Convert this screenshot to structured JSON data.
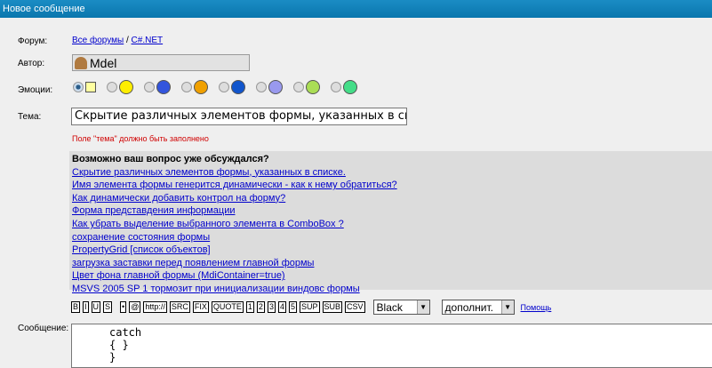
{
  "title": "Новое сообщение",
  "labels": {
    "forum": "Форум:",
    "author": "Автор:",
    "emotions": "Эмоции:",
    "subject": "Тема:",
    "message": "Сообщение:"
  },
  "forum": {
    "all": "Все форумы",
    "sep": "/",
    "current": "C#.NET"
  },
  "author": "Mdel",
  "emotions": [
    {
      "name": "note",
      "color": "#ffffa0",
      "selected": true
    },
    {
      "name": "smile",
      "color": "#ffee00"
    },
    {
      "name": "question",
      "color": "#3355dd"
    },
    {
      "name": "exclaim",
      "color": "#f0a000"
    },
    {
      "name": "sad",
      "color": "#1155cc"
    },
    {
      "name": "shock",
      "color": "#9999ee"
    },
    {
      "name": "cool",
      "color": "#aadd55"
    },
    {
      "name": "grin",
      "color": "#44dd88"
    }
  ],
  "subject": "Скрытие различных элементов формы, указанных в списке",
  "error": "Поле \"тема\" должно быть заполнено",
  "suggestions": {
    "heading": "Возможно ваш вопрос уже обсуждался?",
    "items": [
      "Скрытие различных элементов формы, указанных в списке.",
      "Имя элемента формы генерится динамически - как к нему обратиться?",
      "Как динамически добавить контрол на форму?",
      "Форма представдения информации",
      "Как убрать выделение выбранного элемента в ComboBox ?",
      "сохранение состояния формы",
      "PropertyGrid [список объектов]",
      "загрузка заставки перед появлением главной формы",
      "Цвет фона главной формы (MdiContainer=true)",
      "MSVS 2005 SP 1 тормозит при инициализации виндовс формы"
    ]
  },
  "toolbar": {
    "buttons": [
      "B",
      "I",
      "U",
      "S",
      "•",
      "@",
      "http://",
      "SRC",
      "FIX",
      "QUOTE",
      "1",
      "2",
      "3",
      "4",
      "5",
      "SUP",
      "SUB",
      "CSV"
    ],
    "color": "Black",
    "extra": "дополнит.",
    "help": "Помощь"
  },
  "message": "catch\n{ }\n}"
}
